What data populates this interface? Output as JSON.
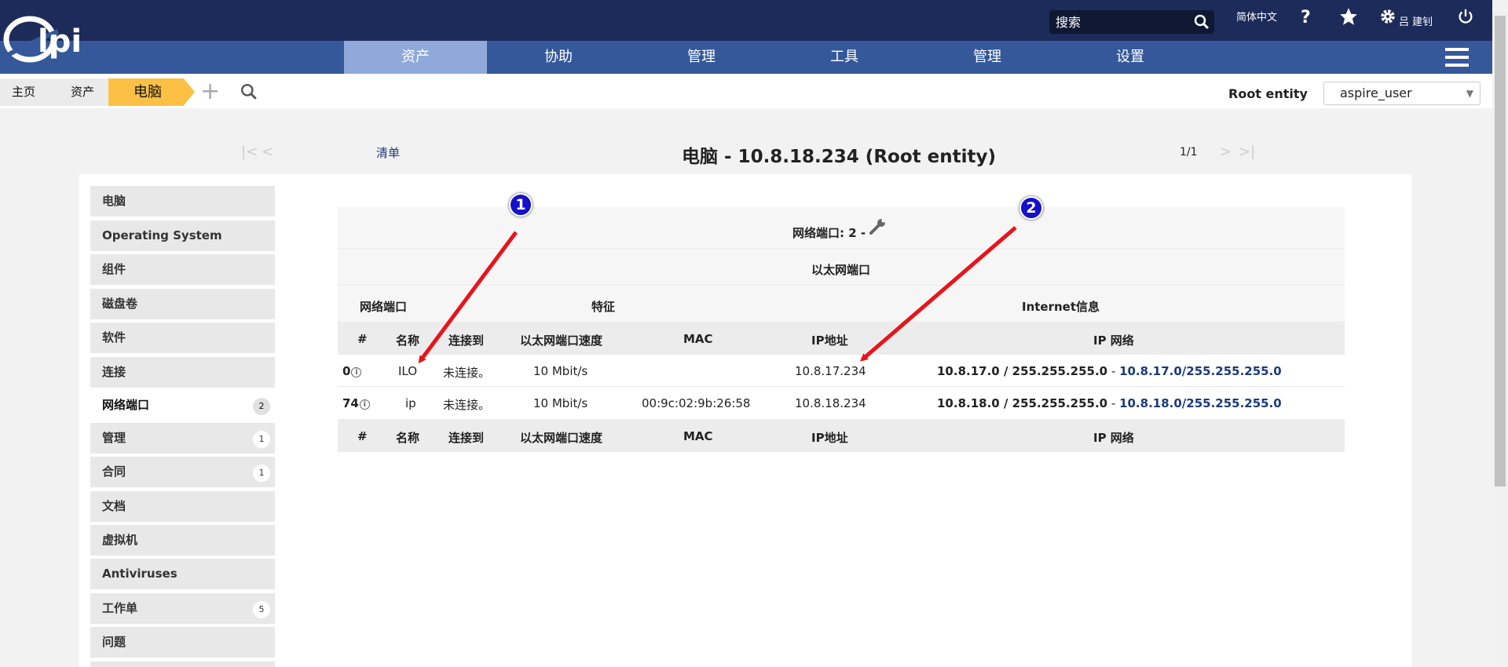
{
  "header": {
    "logo_text": "Glpi",
    "search_placeholder": "搜索",
    "language": "简体中文",
    "username": "吕 建钊"
  },
  "nav": {
    "tabs": [
      "资产",
      "协助",
      "管理",
      "工具",
      "管理",
      "设置"
    ],
    "active_tab": "资产"
  },
  "breadcrumb": {
    "home": "主页",
    "assets": "资产",
    "computer": "电脑"
  },
  "entity": {
    "label": "Root entity",
    "selected": "aspire_user"
  },
  "record_nav": {
    "list_link": "清单",
    "title": "电脑 - 10.8.18.234 (Root entity)",
    "counter": "1/1"
  },
  "sidebar": {
    "items": [
      {
        "label": "电脑",
        "badge": ""
      },
      {
        "label": "Operating System",
        "badge": ""
      },
      {
        "label": "组件",
        "badge": ""
      },
      {
        "label": "磁盘卷",
        "badge": ""
      },
      {
        "label": "软件",
        "badge": ""
      },
      {
        "label": "连接",
        "badge": ""
      },
      {
        "label": "网络端口",
        "badge": "2"
      },
      {
        "label": "管理",
        "badge": "1"
      },
      {
        "label": "合同",
        "badge": "1"
      },
      {
        "label": "文档",
        "badge": ""
      },
      {
        "label": "虚拟机",
        "badge": ""
      },
      {
        "label": "Antiviruses",
        "badge": ""
      },
      {
        "label": "工作单",
        "badge": "5"
      },
      {
        "label": "问题",
        "badge": ""
      }
    ],
    "selected_index": 6
  },
  "ports": {
    "title": "网络端口: 2 -",
    "subtitle": "以太网端口",
    "groups": {
      "port": "网络端口",
      "features": "特征",
      "internet": "Internet信息"
    },
    "columns": [
      "#",
      "名称",
      "连接到",
      "以太网端口速度",
      "MAC",
      "IP地址",
      "IP 网络"
    ],
    "rows": [
      {
        "num": "0",
        "name": "ILO",
        "connected": "未连接。",
        "speed": "10 Mbit/s",
        "mac": "",
        "ip": "10.8.17.234",
        "network": "10.8.17.0 / 255.255.255.0",
        "network_sep": " - ",
        "network_link": "10.8.17.0/255.255.255.0"
      },
      {
        "num": "74",
        "name": "ip",
        "connected": "未连接。",
        "speed": "10 Mbit/s",
        "mac": "00:9c:02:9b:26:58",
        "ip": "10.8.18.234",
        "network": "10.8.18.0 / 255.255.255.0",
        "network_sep": " - ",
        "network_link": "10.8.18.0/255.255.255.0"
      }
    ]
  },
  "annotations": {
    "marker1": "1",
    "marker2": "2"
  },
  "colors": {
    "topbar": "#1d2b5a",
    "navbar": "#35589a",
    "active_tab": "#8fa9da",
    "breadcrumb_active": "#fcc045",
    "marker": "#1511c9",
    "arrow": "#e8141a",
    "link": "#1b3a7a"
  }
}
